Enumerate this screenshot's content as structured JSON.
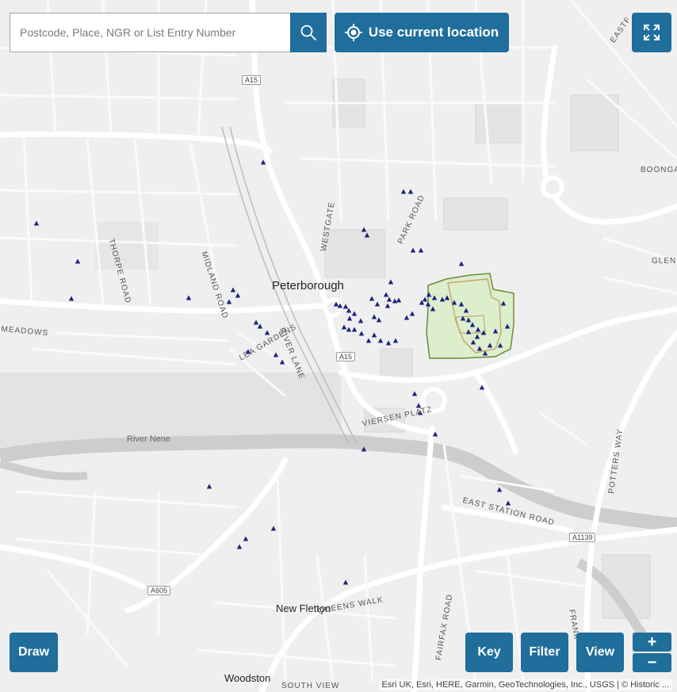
{
  "search": {
    "placeholder": "Postcode, Place, NGR or List Entry Number"
  },
  "toolbar": {
    "location_label": "Use current location",
    "draw_label": "Draw",
    "key_label": "Key",
    "filter_label": "Filter",
    "view_label": "View",
    "zoom_in_label": "+",
    "zoom_out_label": "−"
  },
  "attribution": "Esri UK, Esri, HERE, Garmin, GeoTechnologies, Inc., USGS | © Historic ...",
  "places": {
    "peterborough": "Peterborough",
    "new_fletton": "New Fletton",
    "woodston": "Woodston"
  },
  "streets": {
    "westgate": "WESTGATE",
    "park_road": "PARK ROAD",
    "thorpe_road": "THORPE ROAD",
    "midland_road": "MIDLAND ROAD",
    "lea_gardens": "LEA GARDENS",
    "river_lane": "RIVER LANE",
    "meadows": "MEADOWS",
    "viersen_platz": "VIERSEN PLATZ",
    "east_station_road": "EAST STATION ROAD",
    "potters_way": "POTTERS WAY",
    "frank": "FRANK",
    "queens_walk": "QUEENS WALK",
    "fairfax_road": "FAIRFAX ROAD",
    "south_view": "SOUTH VIEW",
    "boongate": "BOONGA",
    "glens": "GLENS",
    "eastfield": "EASTF"
  },
  "roads": {
    "a15_north": "A15",
    "a15_centre": "A15",
    "a1139": "A1139",
    "a605": "A605"
  },
  "water": {
    "river_nene": "River Nene"
  },
  "colors": {
    "accent": "#1f6e9c",
    "marker": "#1a237e",
    "conservation_fill": "#d8edc4",
    "conservation_stroke": "#6b8a3a",
    "river": "#c9c9c9",
    "park": "#dcdcdc"
  },
  "icons": {
    "search": "search-icon",
    "location": "crosshair-icon",
    "fullscreen": "fullscreen-icon",
    "marker": "triangle-marker-icon"
  }
}
